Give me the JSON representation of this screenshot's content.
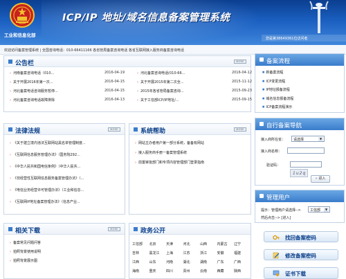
{
  "header": {
    "org_name": "工业和信息化部",
    "site_title": "ICP/IP 地址/域名信息备案管理系统",
    "visitor_text": "您是第38649361位访问者"
  },
  "notice_bar": "欢迎访问备案管理系统 | 全国咨询电话：010-66411166 各省管局备案咨询电话 各省互联网接入服务商备案咨询电话",
  "announcements": {
    "title": "公告栏",
    "more": "MORE",
    "items": [
      {
        "text": "河南备案咨询电话（010...",
        "date": "2016-04-19"
      },
      {
        "text": "关于开展2016年第一次...",
        "date": "2016-04-15"
      },
      {
        "text": "河北备案电话咨询服务暂停...",
        "date": "2016-04-15"
      },
      {
        "text": "河北备案咨询电话故障排除",
        "date": "2016-04-13"
      },
      {
        "text": "河北备案咨询电话(010-66...",
        "date": "2016-04-12"
      },
      {
        "text": "关于开展2015年第二次全...",
        "date": "2015-11-12"
      },
      {
        "text": "2015年各省管局备案咨询...",
        "date": "2015-09-23"
      },
      {
        "text": "关于工信部ICP/IP地址/...",
        "date": "2015-09-15"
      }
    ]
  },
  "laws": {
    "title": "法律法规",
    "more": "MORE",
    "items": [
      "《关于建立境内违法互联网站黑名单管理制度...",
      "《互联网信息服务管理办法》（国务院292...",
      "《中华人民共和国电信条例》（中华人民共...",
      "《非经营性互联网信息服务备案管理办法》（...",
      "《电信业务经营许可管理办法》（工业和信息...",
      "《互联网IP地址备案管理办法》（信息产业..."
    ]
  },
  "help": {
    "title": "系统帮助",
    "more": "MORE",
    "items": [
      "网站主办者用户第一部分系统，备备有网站",
      "接入服务商手册一备案管理系统",
      "前置审批部门和专项内容管理部门登录指南"
    ]
  },
  "downloads": {
    "title": "相关下载",
    "more": "MORE",
    "items": [
      "备案常见问题问答",
      "拍照背景使用说明",
      "拍照背景展示图"
    ]
  },
  "gov": {
    "title": "政务公开",
    "cities": [
      [
        "工信部",
        "北京",
        "天津",
        "河北",
        "山西",
        "内蒙古",
        "辽宁"
      ],
      [
        "吉林",
        "黑龙江",
        "上海",
        "江苏",
        "浙江",
        "安徽",
        "福建"
      ],
      [
        "江西",
        "山东",
        "河南",
        "湖北",
        "湖南",
        "广东",
        "广西"
      ],
      [
        "海南",
        "重庆",
        "四川",
        "贵州",
        "云南",
        "西藏",
        "陕西"
      ]
    ]
  },
  "process": {
    "title": "备案流程",
    "items": [
      "新备案流程",
      "ICP变更流程",
      "IP地址报备流程",
      "域名信息报备流程",
      "ICP备案流程演示"
    ]
  },
  "self_nav": {
    "title": "自行备案导航",
    "province_label": "接入商所在省：",
    "province_value": "请选择",
    "name_label": "接入商名称：",
    "code_label": "验证码：",
    "captcha_text": "1u2q",
    "go_button": "进入"
  },
  "admin": {
    "title": "管理用户",
    "prompt": "提示：管理用户请选择-->",
    "select_value": "工信部",
    "then_click": "然后点击--> [进入]"
  },
  "actions": {
    "find_password": "找回备案密码",
    "change_password": "修改备案密码",
    "cert_download": "证书下载"
  },
  "colors": {
    "brand_blue": "#0a3f8a",
    "header_blue": "#1a5fc0",
    "arrow_red": "#c0392b"
  }
}
